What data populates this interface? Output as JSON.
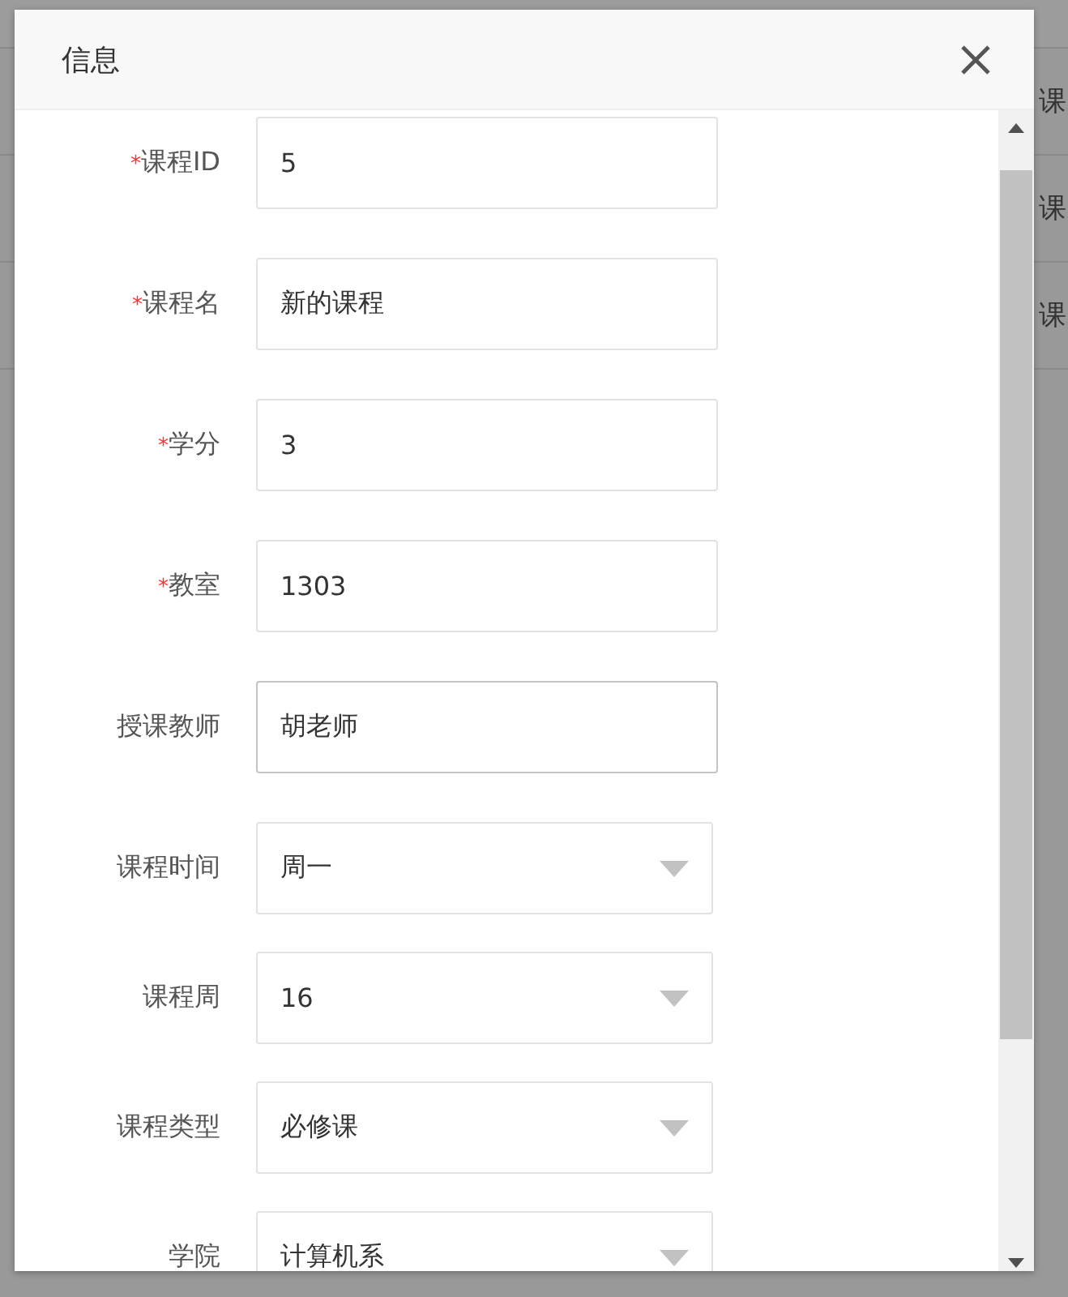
{
  "background_table": {
    "rows": [
      {
        "column_4": "课"
      },
      {
        "column_4": "课"
      },
      {
        "column_4": "课"
      }
    ]
  },
  "dialog": {
    "title": "信息",
    "fields": [
      {
        "kind": "input",
        "required_mark": "*",
        "label": "课程ID",
        "value": "5",
        "focused": false
      },
      {
        "kind": "input",
        "required_mark": "*",
        "label": "课程名",
        "value": "新的课程",
        "focused": false
      },
      {
        "kind": "input",
        "required_mark": "*",
        "label": "学分",
        "value": "3",
        "focused": false
      },
      {
        "kind": "input",
        "required_mark": "*",
        "label": "教室",
        "value": "1303",
        "focused": false
      },
      {
        "kind": "input",
        "label": "授课教师",
        "value": "胡老师",
        "focused": true
      },
      {
        "kind": "select",
        "label": "课程时间",
        "value": "周一"
      },
      {
        "kind": "select",
        "label": "课程周",
        "value": "16"
      },
      {
        "kind": "select",
        "label": "课程类型",
        "value": "必修课"
      },
      {
        "kind": "select",
        "label": "学院",
        "value": "计算机系"
      }
    ]
  }
}
